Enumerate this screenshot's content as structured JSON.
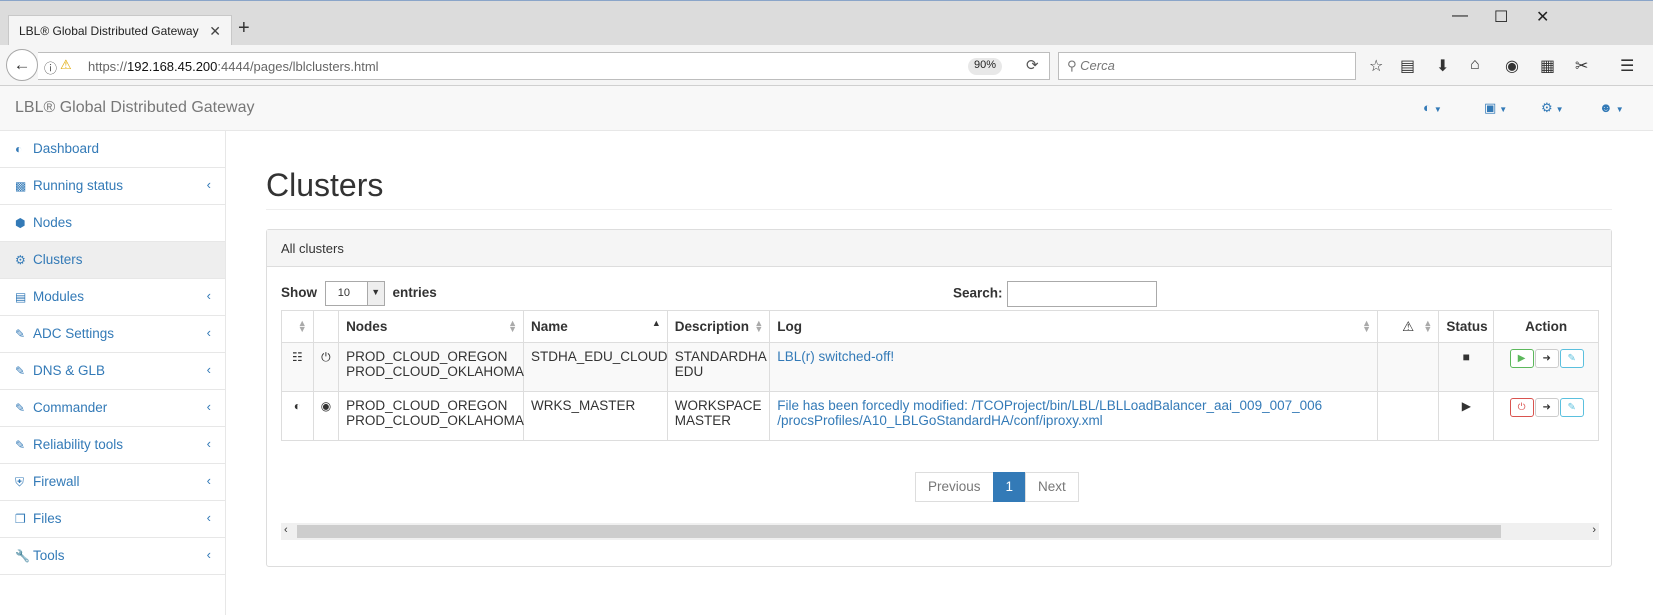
{
  "browser": {
    "tab_title": "LBL® Global Distributed Gateway",
    "tab_close": "✕",
    "new_tab": "+",
    "url_scheme": "https://",
    "url_host": "192.168.45.200",
    "url_rest": ":4444/pages/lblclusters.html",
    "zoom": "90%",
    "search_placeholder": "Cerca"
  },
  "app": {
    "brand": "LBL® Global Distributed Gateway"
  },
  "sidebar": {
    "items": [
      {
        "label": "Dashboard",
        "icon": "dashboard-icon"
      },
      {
        "label": "Running status",
        "icon": "bar-chart-icon"
      },
      {
        "label": "Nodes",
        "icon": "cube-icon"
      },
      {
        "label": "Clusters",
        "icon": "cogs-icon"
      },
      {
        "label": "Modules",
        "icon": "list-icon"
      },
      {
        "label": "ADC Settings",
        "icon": "edit-icon"
      },
      {
        "label": "DNS & GLB",
        "icon": "edit-icon"
      },
      {
        "label": "Commander",
        "icon": "edit-icon"
      },
      {
        "label": "Reliability tools",
        "icon": "edit-icon"
      },
      {
        "label": "Firewall",
        "icon": "shield-icon"
      },
      {
        "label": "Files",
        "icon": "files-icon"
      },
      {
        "label": "Tools",
        "icon": "wrench-icon"
      }
    ]
  },
  "main": {
    "title": "Clusters",
    "panel_heading": "All clusters",
    "show_label": "Show",
    "entries_label": "entries",
    "entries_value": "10",
    "search_label": "Search:",
    "search_value": "",
    "columns": {
      "nodes": "Nodes",
      "name": "Name",
      "description": "Description",
      "log": "Log",
      "status": "Status",
      "action": "Action"
    },
    "rows": [
      {
        "nodes_1": "PROD_CLOUD_OREGON",
        "nodes_2": "PROD_CLOUD_OKLAHOMA",
        "name": "STDHA_EDU_CLOUD",
        "desc_1": "STANDARDHA",
        "desc_2": "EDU",
        "log_1": "LBL(r) switched-off!",
        "log_2": "",
        "type_icon": "sitemap-icon",
        "power_icon": "power-icon",
        "status_icon": "stop-icon",
        "action_primary": "play"
      },
      {
        "nodes_1": "PROD_CLOUD_OREGON",
        "nodes_2": "PROD_CLOUD_OKLAHOMA",
        "name": "WRKS_MASTER",
        "desc_1": "WORKSPACE",
        "desc_2": "MASTER",
        "log_1": "File has been forcedly modified: /TCOProject/bin/LBL/LBLLoadBalancer_aai_009_007_006",
        "log_2": "/procsProfiles/A10_LBLGoStandardHA/conf/iproxy.xml",
        "type_icon": "dashboard-icon",
        "power_icon": "play-circle-icon",
        "status_icon": "play-icon",
        "action_primary": "power"
      }
    ],
    "pagination": {
      "previous": "Previous",
      "current": "1",
      "next": "Next"
    }
  },
  "colors": {
    "link": "#337ab7",
    "success": "#5cb85c",
    "danger": "#d9534f",
    "info": "#5bc0de"
  }
}
